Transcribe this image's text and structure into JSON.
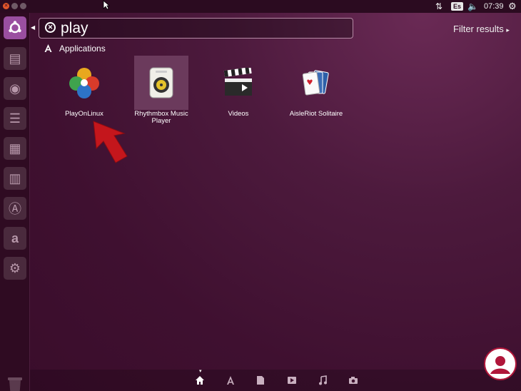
{
  "topbar": {
    "keyboard_layout": "Es",
    "time": "07:39",
    "icons": [
      "close-icon",
      "minimize-icon",
      "maximize-icon",
      "network-icon",
      "volume-icon",
      "settings-gear-icon"
    ]
  },
  "launcher": {
    "items": [
      {
        "name": "ubuntu-dash-icon"
      },
      {
        "name": "files-icon"
      },
      {
        "name": "firefox-icon"
      },
      {
        "name": "writer-icon"
      },
      {
        "name": "calc-icon"
      },
      {
        "name": "impress-icon"
      },
      {
        "name": "software-center-icon"
      },
      {
        "name": "amazon-icon"
      },
      {
        "name": "system-settings-icon"
      },
      {
        "name": "trash-icon"
      }
    ]
  },
  "search": {
    "query": "play",
    "filter_label": "Filter results"
  },
  "section": {
    "title": "Applications"
  },
  "apps": [
    {
      "label": "PlayOnLinux",
      "icon": "playonlinux-icon"
    },
    {
      "label": "Rhythmbox Music Player",
      "label_line1": "Rhythmbox Music",
      "label_line2": "Player",
      "icon": "rhythmbox-icon"
    },
    {
      "label": "Videos",
      "icon": "videos-icon"
    },
    {
      "label": "AisleRiot Solitaire",
      "icon": "solitaire-icon"
    }
  ],
  "lenses": [
    "home-lens-icon",
    "applications-lens-icon",
    "files-lens-icon",
    "video-lens-icon",
    "music-lens-icon",
    "photos-lens-icon"
  ],
  "colors": {
    "background": "#3d0f2c",
    "panel": "#2b0b20",
    "accent": "#9a4fa0",
    "annotation_arrow": "#c4161c"
  }
}
